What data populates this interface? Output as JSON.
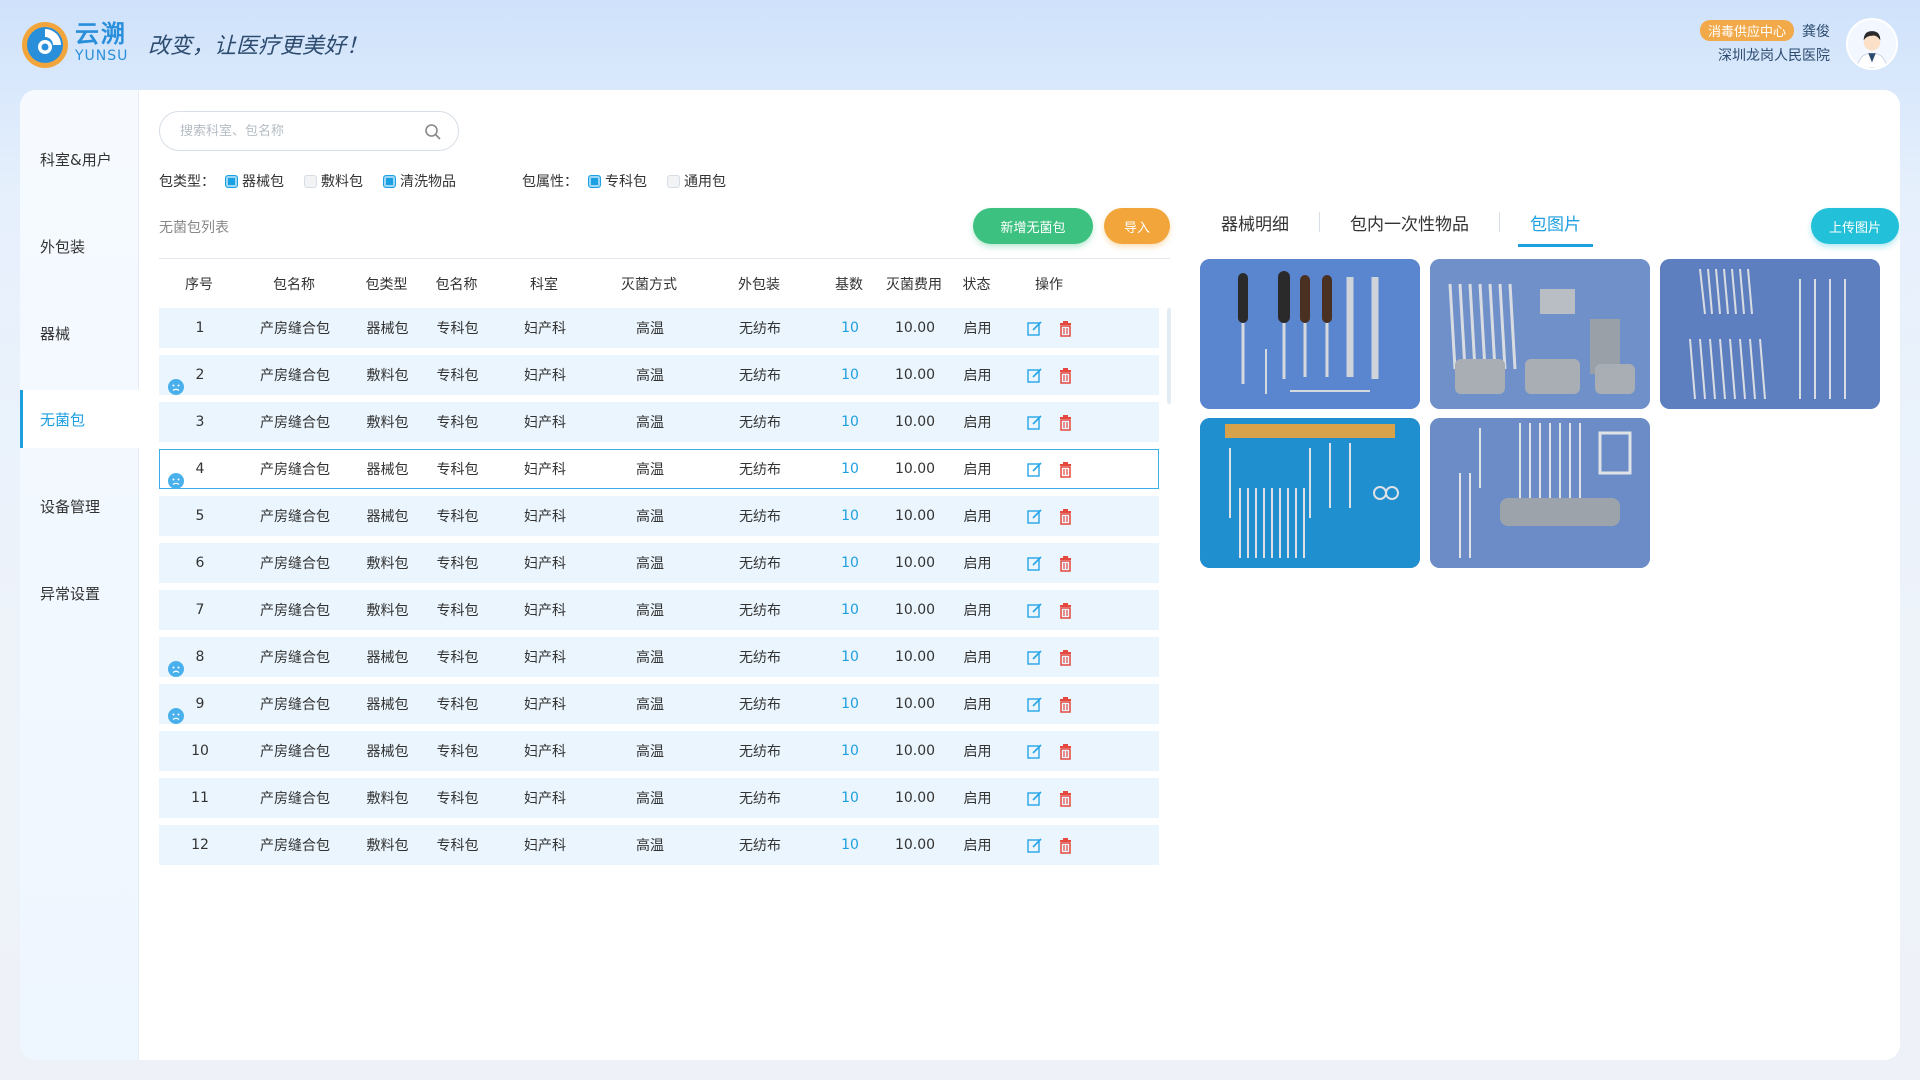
{
  "brand": {
    "cn": "云溯",
    "en": "YUNSU",
    "slogan": "改变，让医疗更美好！"
  },
  "user": {
    "dept_badge": "消毒供应中心",
    "name": "龚俊",
    "hospital": "深圳龙岗人民医院"
  },
  "sidebar": {
    "items": [
      {
        "label": "科室&用户",
        "active": false
      },
      {
        "label": "外包装",
        "active": false
      },
      {
        "label": "器械",
        "active": false
      },
      {
        "label": "无菌包",
        "active": true
      },
      {
        "label": "设备管理",
        "active": false
      },
      {
        "label": "异常设置",
        "active": false
      }
    ]
  },
  "search": {
    "placeholder": "搜索科室、包名称",
    "value": ""
  },
  "filters": {
    "type_label": "包类型：",
    "type_options": [
      {
        "label": "器械包",
        "checked": true
      },
      {
        "label": "敷料包",
        "checked": false
      },
      {
        "label": "清洗物品",
        "checked": true
      }
    ],
    "attr_label": "包属性：",
    "attr_options": [
      {
        "label": "专科包",
        "checked": true
      },
      {
        "label": "通用包",
        "checked": false
      }
    ]
  },
  "list": {
    "title": "无菌包列表",
    "add_button": "新增无菌包",
    "import_button": "导入",
    "columns": [
      "序号",
      "包名称",
      "包类型",
      "包名称",
      "科室",
      "灭菌方式",
      "外包装",
      "基数",
      "灭菌费用",
      "状态",
      "操作"
    ],
    "rows": [
      {
        "no": "1",
        "name": "产房缝合包",
        "type": "器械包",
        "attr": "专科包",
        "dept": "妇产科",
        "method": "高温",
        "wrap": "无纺布",
        "base": "10",
        "fee": "10.00",
        "status": "启用",
        "icon": false,
        "selected": false
      },
      {
        "no": "2",
        "name": "产房缝合包",
        "type": "敷料包",
        "attr": "专科包",
        "dept": "妇产科",
        "method": "高温",
        "wrap": "无纺布",
        "base": "10",
        "fee": "10.00",
        "status": "启用",
        "icon": true,
        "selected": false
      },
      {
        "no": "3",
        "name": "产房缝合包",
        "type": "敷料包",
        "attr": "专科包",
        "dept": "妇产科",
        "method": "高温",
        "wrap": "无纺布",
        "base": "10",
        "fee": "10.00",
        "status": "启用",
        "icon": false,
        "selected": false
      },
      {
        "no": "4",
        "name": "产房缝合包",
        "type": "器械包",
        "attr": "专科包",
        "dept": "妇产科",
        "method": "高温",
        "wrap": "无纺布",
        "base": "10",
        "fee": "10.00",
        "status": "启用",
        "icon": true,
        "selected": true
      },
      {
        "no": "5",
        "name": "产房缝合包",
        "type": "器械包",
        "attr": "专科包",
        "dept": "妇产科",
        "method": "高温",
        "wrap": "无纺布",
        "base": "10",
        "fee": "10.00",
        "status": "启用",
        "icon": false,
        "selected": false
      },
      {
        "no": "6",
        "name": "产房缝合包",
        "type": "敷料包",
        "attr": "专科包",
        "dept": "妇产科",
        "method": "高温",
        "wrap": "无纺布",
        "base": "10",
        "fee": "10.00",
        "status": "启用",
        "icon": false,
        "selected": false
      },
      {
        "no": "7",
        "name": "产房缝合包",
        "type": "敷料包",
        "attr": "专科包",
        "dept": "妇产科",
        "method": "高温",
        "wrap": "无纺布",
        "base": "10",
        "fee": "10.00",
        "status": "启用",
        "icon": false,
        "selected": false
      },
      {
        "no": "8",
        "name": "产房缝合包",
        "type": "器械包",
        "attr": "专科包",
        "dept": "妇产科",
        "method": "高温",
        "wrap": "无纺布",
        "base": "10",
        "fee": "10.00",
        "status": "启用",
        "icon": true,
        "selected": false
      },
      {
        "no": "9",
        "name": "产房缝合包",
        "type": "器械包",
        "attr": "专科包",
        "dept": "妇产科",
        "method": "高温",
        "wrap": "无纺布",
        "base": "10",
        "fee": "10.00",
        "status": "启用",
        "icon": true,
        "selected": false
      },
      {
        "no": "10",
        "name": "产房缝合包",
        "type": "器械包",
        "attr": "专科包",
        "dept": "妇产科",
        "method": "高温",
        "wrap": "无纺布",
        "base": "10",
        "fee": "10.00",
        "status": "启用",
        "icon": false,
        "selected": false
      },
      {
        "no": "11",
        "name": "产房缝合包",
        "type": "敷料包",
        "attr": "专科包",
        "dept": "妇产科",
        "method": "高温",
        "wrap": "无纺布",
        "base": "10",
        "fee": "10.00",
        "status": "启用",
        "icon": false,
        "selected": false
      },
      {
        "no": "12",
        "name": "产房缝合包",
        "type": "敷料包",
        "attr": "专科包",
        "dept": "妇产科",
        "method": "高温",
        "wrap": "无纺布",
        "base": "10",
        "fee": "10.00",
        "status": "启用",
        "icon": false,
        "selected": false
      }
    ]
  },
  "detail": {
    "tabs": [
      {
        "label": "器械明细",
        "active": false
      },
      {
        "label": "包内一次性物品",
        "active": false
      },
      {
        "label": "包图片",
        "active": true
      }
    ],
    "upload_button": "上传图片",
    "photos": [
      "surgical-tools-photo",
      "retractors-photo",
      "scissors-photo",
      "forceps-photo",
      "clamps-photo"
    ]
  },
  "colors": {
    "accent": "#1e9fe0",
    "add": "#3dc180",
    "import": "#f2a53a",
    "upload": "#22c1d9",
    "badge": "#f2a94a",
    "delete": "#e4483f"
  }
}
